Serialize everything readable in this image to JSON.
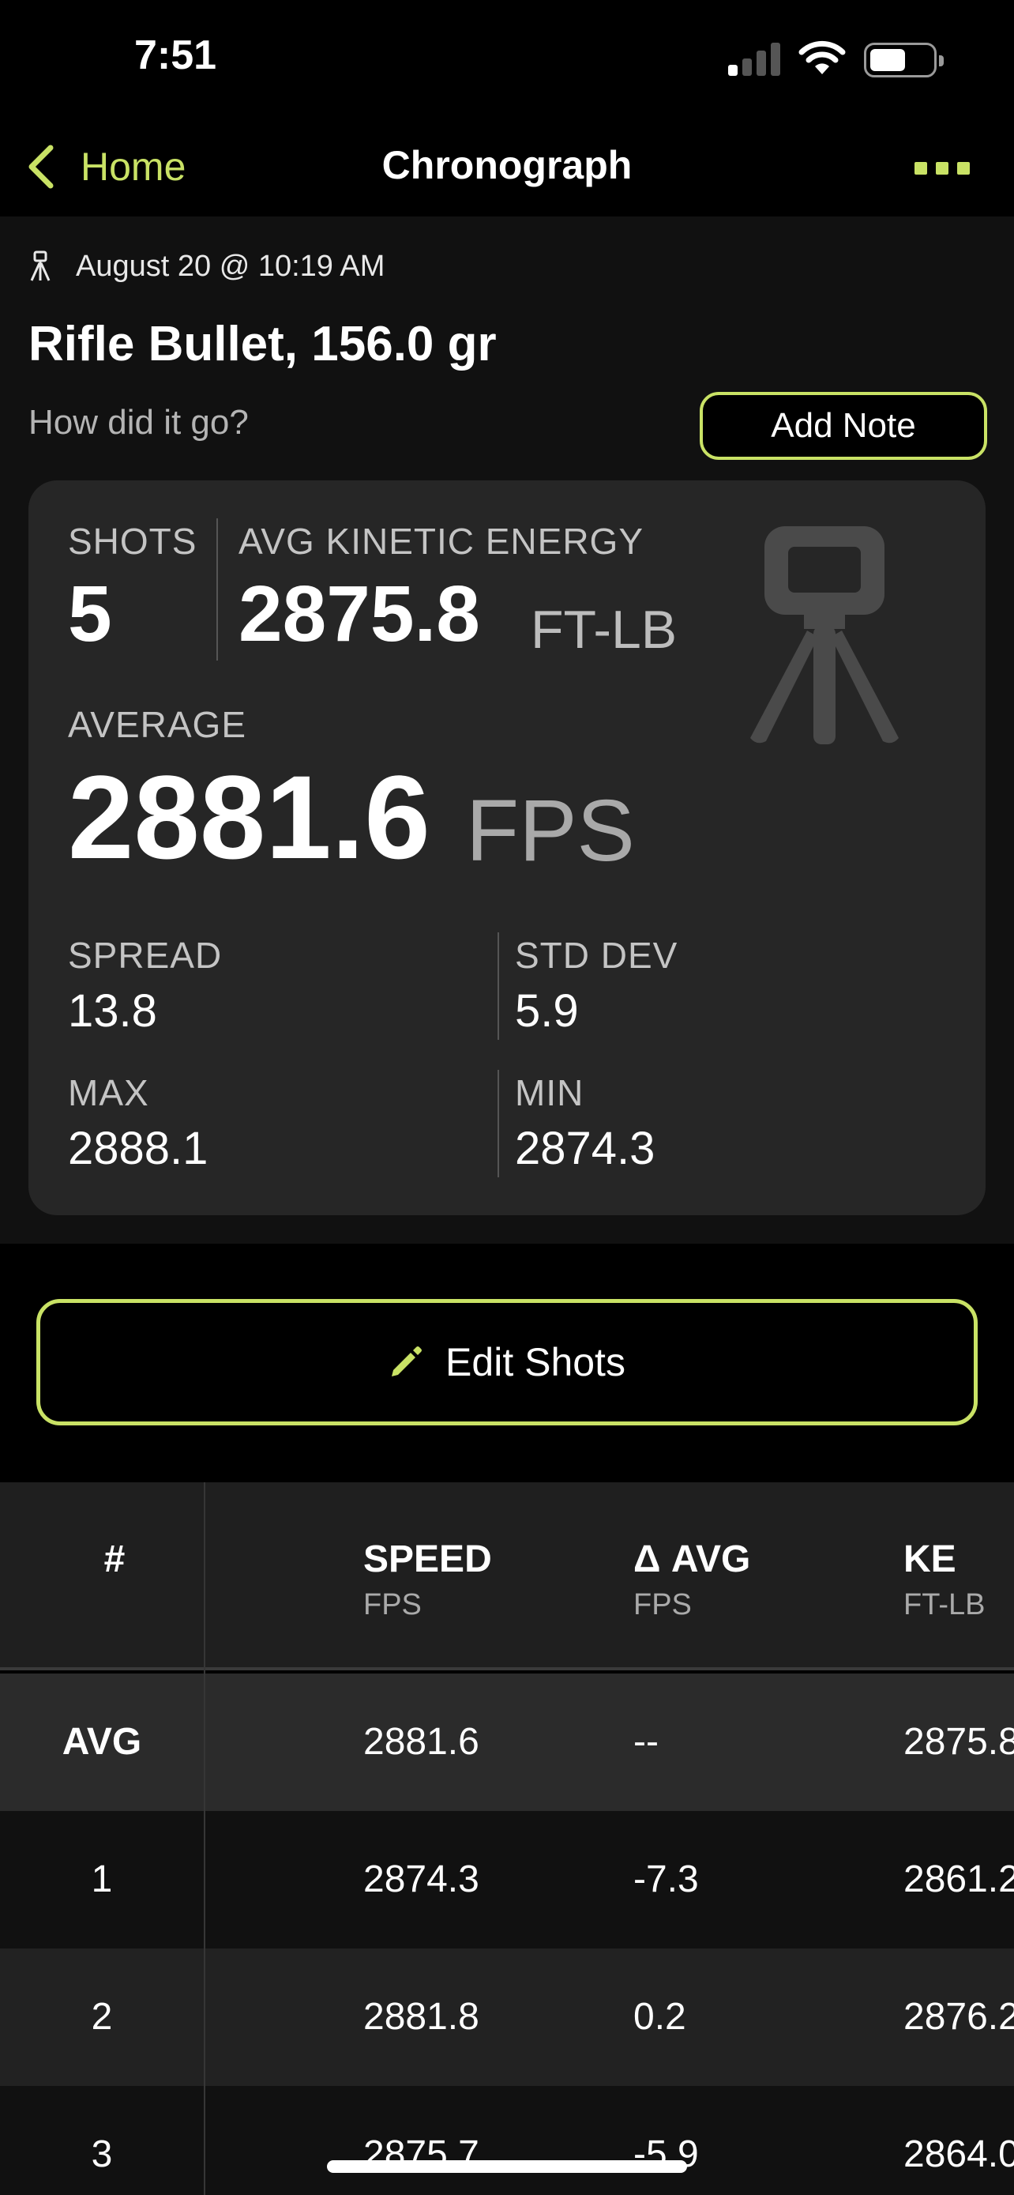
{
  "status_bar": {
    "time": "7:51"
  },
  "nav": {
    "back_label": "Home",
    "title": "Chronograph",
    "more_icon": "ellipsis-icon"
  },
  "session": {
    "date": "August 20 @ 10:19 AM",
    "title": "Rifle Bullet, 156.0 gr",
    "prompt": "How did it go?",
    "add_note_label": "Add Note"
  },
  "stats": {
    "shots_label": "SHOTS",
    "shots_value": "5",
    "ke_label": "AVG KINETIC ENERGY",
    "ke_value": "2875.8",
    "ke_unit": "FT-LB",
    "average_label": "AVERAGE",
    "average_value": "2881.6",
    "average_unit": "FPS",
    "spread_label": "SPREAD",
    "spread_value": "13.8",
    "std_dev_label": "STD DEV",
    "std_dev_value": "5.9",
    "max_label": "MAX",
    "max_value": "2888.1",
    "min_label": "MIN",
    "min_value": "2874.3"
  },
  "edit_shots_label": "Edit Shots",
  "table": {
    "columns": [
      {
        "title": "#",
        "unit": ""
      },
      {
        "title": "SPEED",
        "unit": "FPS"
      },
      {
        "title": "Δ AVG",
        "unit": "FPS"
      },
      {
        "title": "KE",
        "unit": "FT-LB"
      }
    ],
    "rows": [
      {
        "num": "AVG",
        "speed": "2881.6",
        "delta": "--",
        "ke": "2875.8"
      },
      {
        "num": "1",
        "speed": "2874.3",
        "delta": "-7.3",
        "ke": "2861.2"
      },
      {
        "num": "2",
        "speed": "2881.8",
        "delta": "0.2",
        "ke": "2876.2"
      },
      {
        "num": "3",
        "speed": "2875.7",
        "delta": "-5.9",
        "ke": "2864.0"
      }
    ]
  },
  "colors": {
    "accent": "#c9e265",
    "background": "#000000",
    "card": "#262626"
  }
}
